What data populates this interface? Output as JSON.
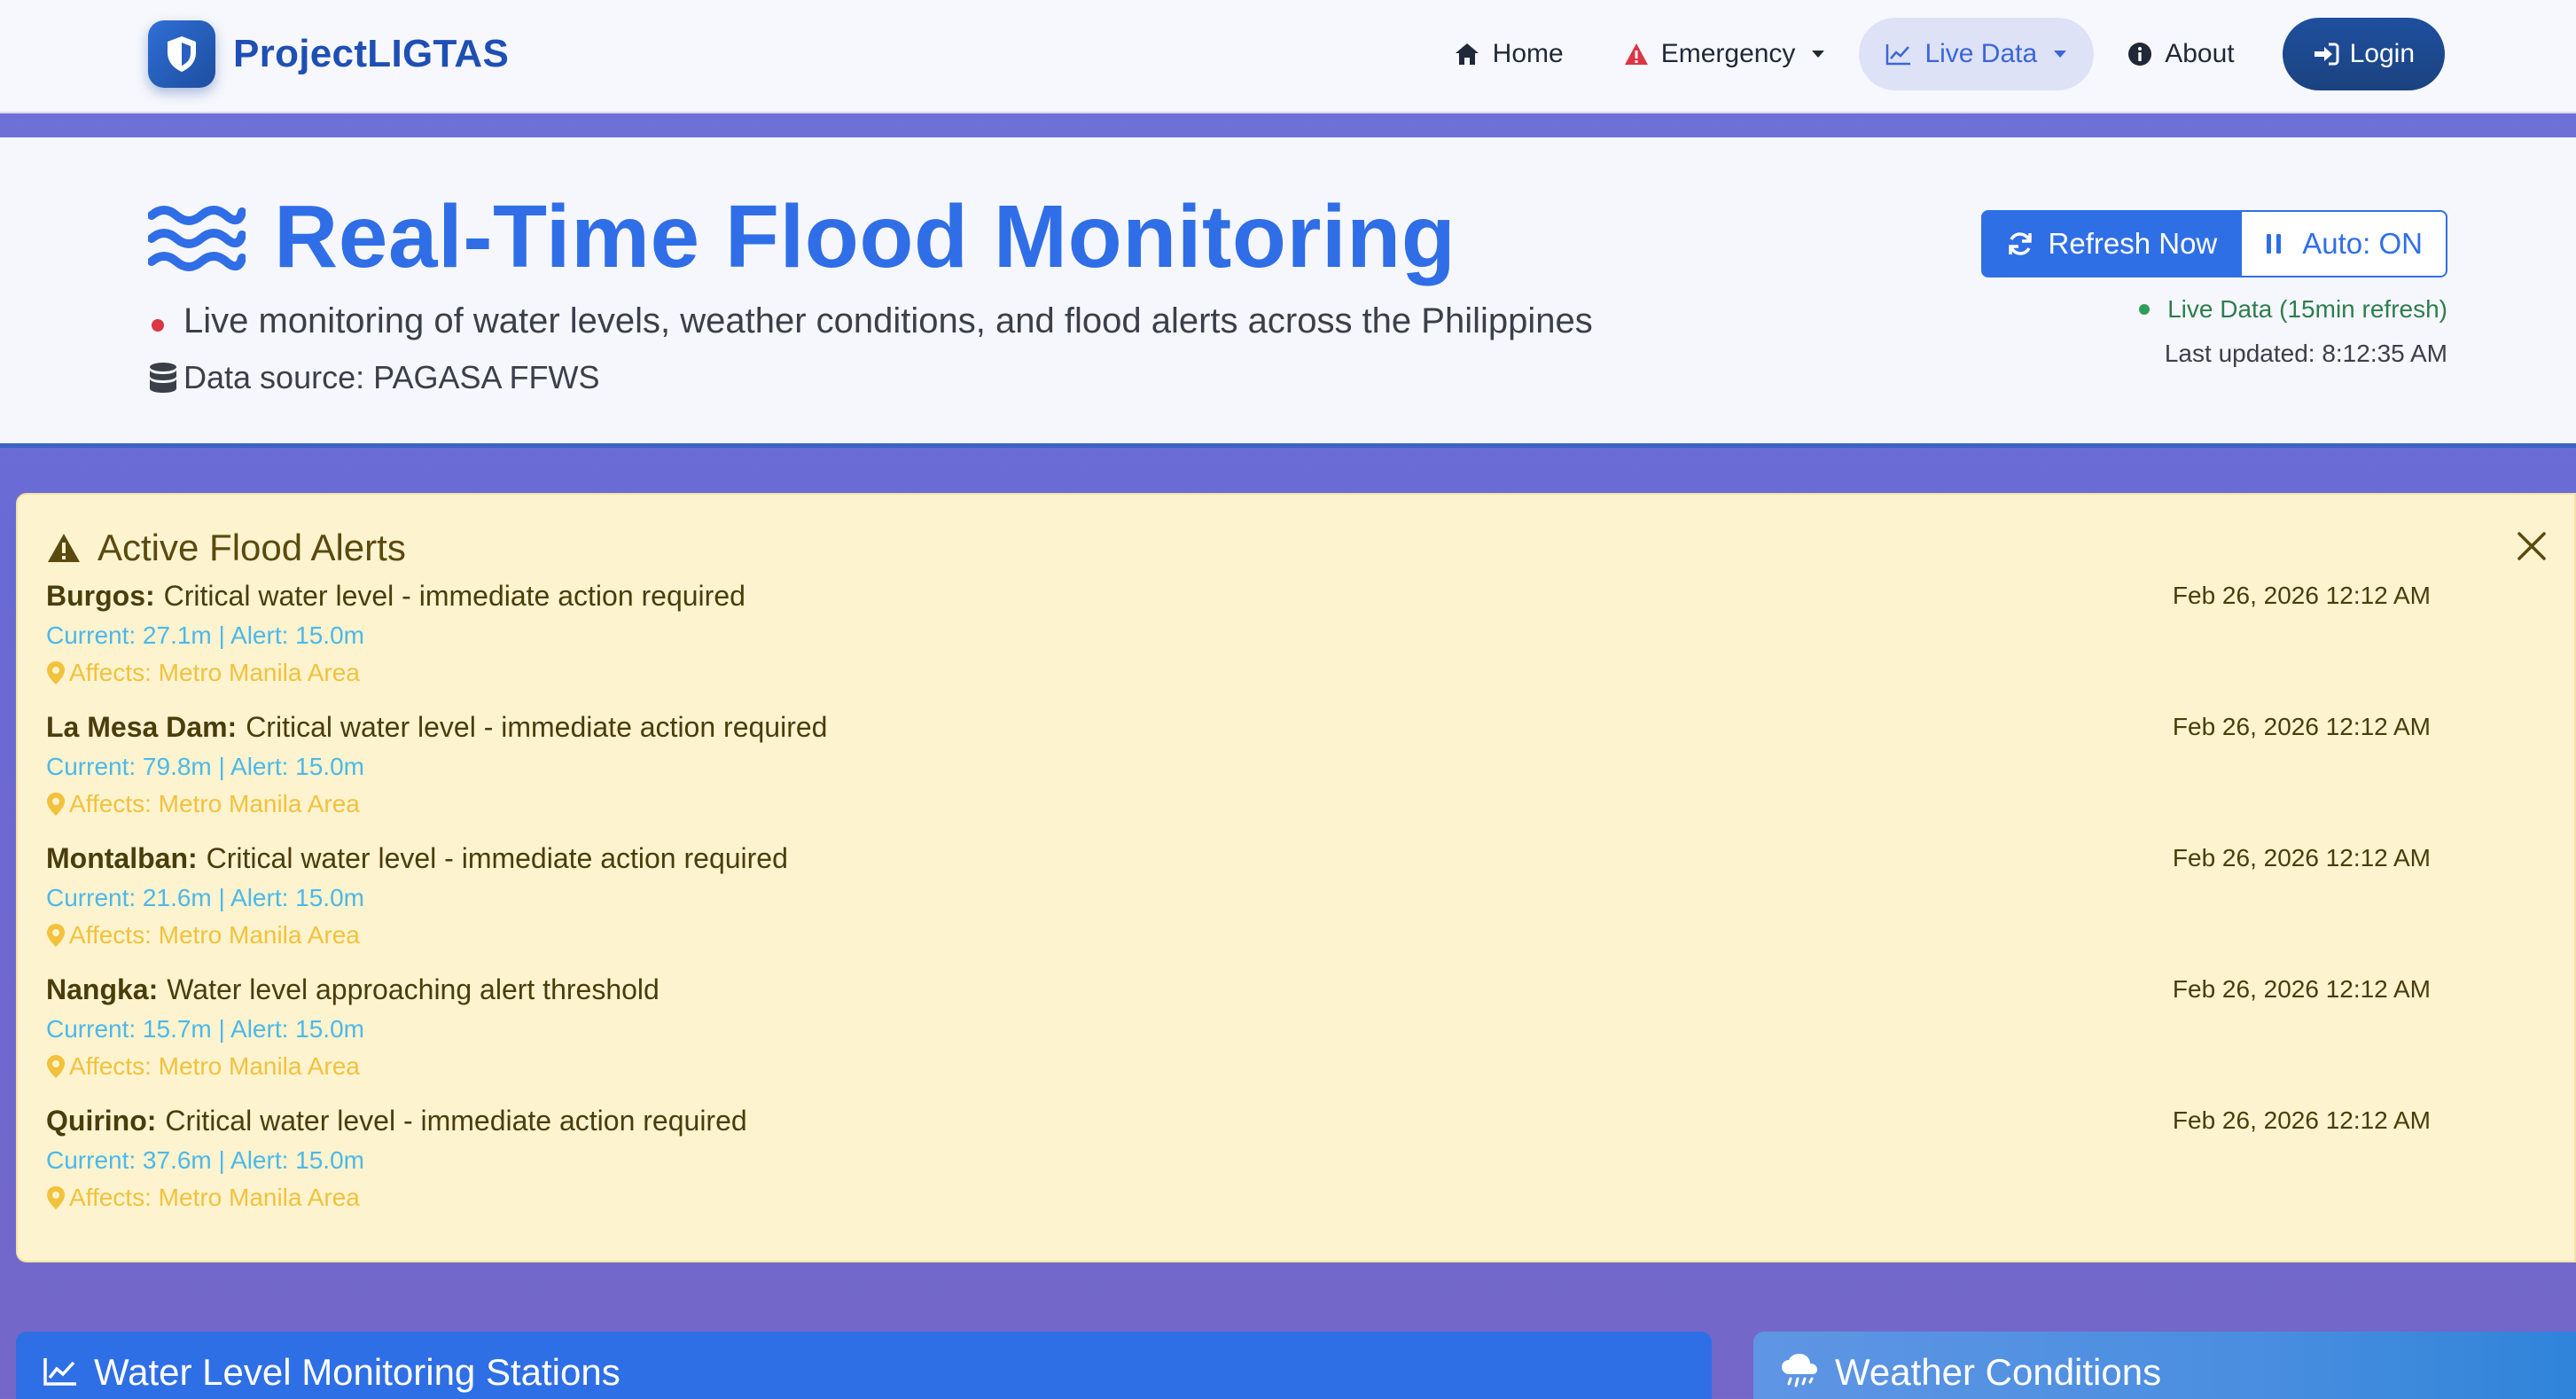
{
  "navbar": {
    "brand": "ProjectLIGTAS",
    "home": "Home",
    "emergency": "Emergency",
    "live_data": "Live Data",
    "about": "About",
    "login": "Login"
  },
  "header": {
    "title": "Real-Time Flood Monitoring",
    "subtitle": "Live monitoring of water levels, weather conditions, and flood alerts across the Philippines",
    "source": "Data source: PAGASA FFWS",
    "refresh_button": "Refresh Now",
    "auto_button": "Auto: ON",
    "live_status": "Live Data (15min refresh)",
    "last_updated": "Last updated: 8:12:35 AM"
  },
  "alerts": {
    "heading": "Active Flood Alerts",
    "items": [
      {
        "station": "Burgos:",
        "message": "Critical water level - immediate action required",
        "levels": "Current: 27.1m | Alert: 15.0m",
        "affects": "Affects: Metro Manila Area",
        "time": "Feb 26, 2026 12:12 AM"
      },
      {
        "station": "La Mesa Dam:",
        "message": "Critical water level - immediate action required",
        "levels": "Current: 79.8m | Alert: 15.0m",
        "affects": "Affects: Metro Manila Area",
        "time": "Feb 26, 2026 12:12 AM"
      },
      {
        "station": "Montalban:",
        "message": "Critical water level - immediate action required",
        "levels": "Current: 21.6m | Alert: 15.0m",
        "affects": "Affects: Metro Manila Area",
        "time": "Feb 26, 2026 12:12 AM"
      },
      {
        "station": "Nangka:",
        "message": "Water level approaching alert threshold",
        "levels": "Current: 15.7m | Alert: 15.0m",
        "affects": "Affects: Metro Manila Area",
        "time": "Feb 26, 2026 12:12 AM"
      },
      {
        "station": "Quirino:",
        "message": "Critical water level - immediate action required",
        "levels": "Current: 37.6m | Alert: 15.0m",
        "affects": "Affects: Metro Manila Area",
        "time": "Feb 26, 2026 12:12 AM"
      }
    ]
  },
  "cards": {
    "water_stations": "Water Level Monitoring Stations",
    "weather": "Weather Conditions"
  },
  "colors": {
    "primary": "#2f6fe6",
    "brand": "#1e4fb4",
    "alert_bg": "#fdf3cf",
    "info": "#4db8e8",
    "warning": "#f2c23c",
    "danger": "#dc3545",
    "success": "#2e9d5c"
  },
  "icons": {
    "brand": "shield-icon",
    "home": "home-icon",
    "emergency": "warning-triangle-icon",
    "live_data": "chart-line-icon",
    "about": "info-circle-icon",
    "login": "sign-in-icon",
    "title": "water-waves-icon",
    "source": "database-icon",
    "refresh": "sync-icon",
    "auto": "pause-icon",
    "alerts": "warning-triangle-icon",
    "close": "close-icon",
    "affects": "map-pin-icon",
    "water_card": "chart-line-icon",
    "weather_card": "cloud-rain-icon"
  }
}
